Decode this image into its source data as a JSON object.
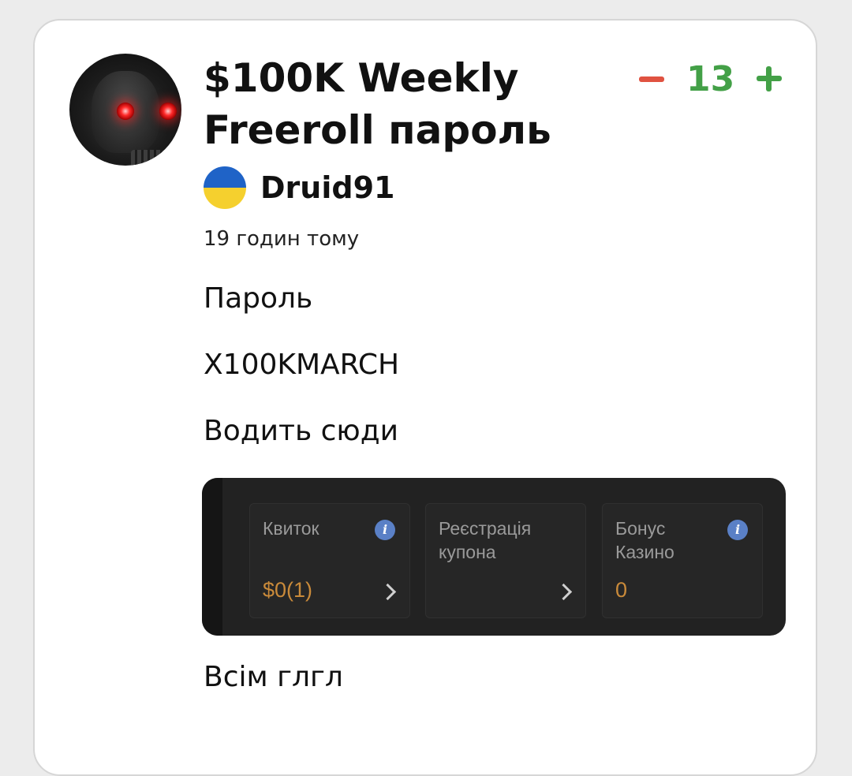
{
  "post": {
    "title": "$100K Weekly Freeroll пароль",
    "votes": {
      "minus_icon": "minus-icon",
      "count": "13",
      "plus_icon": "plus-icon",
      "count_color": "#43a047",
      "minus_color": "#e05241"
    },
    "author": {
      "name": "Druid91",
      "flag_icon": "ukraine-flag-icon"
    },
    "timestamp": "19 годин тому",
    "body": {
      "line1": "Пароль",
      "line2": "X100KMARCH",
      "line3": "Водить сюди",
      "line4": "Всім глгл"
    },
    "embed": {
      "tiles": [
        {
          "label": "Квиток",
          "value": "$0(1)",
          "has_info": true,
          "has_chevron": true
        },
        {
          "label": "Реєстрація купона",
          "value": "",
          "has_info": false,
          "has_chevron": true
        },
        {
          "label": "Бонус Казино",
          "value": "0",
          "has_info": true,
          "has_chevron": false
        }
      ],
      "info_glyph": "i"
    }
  }
}
